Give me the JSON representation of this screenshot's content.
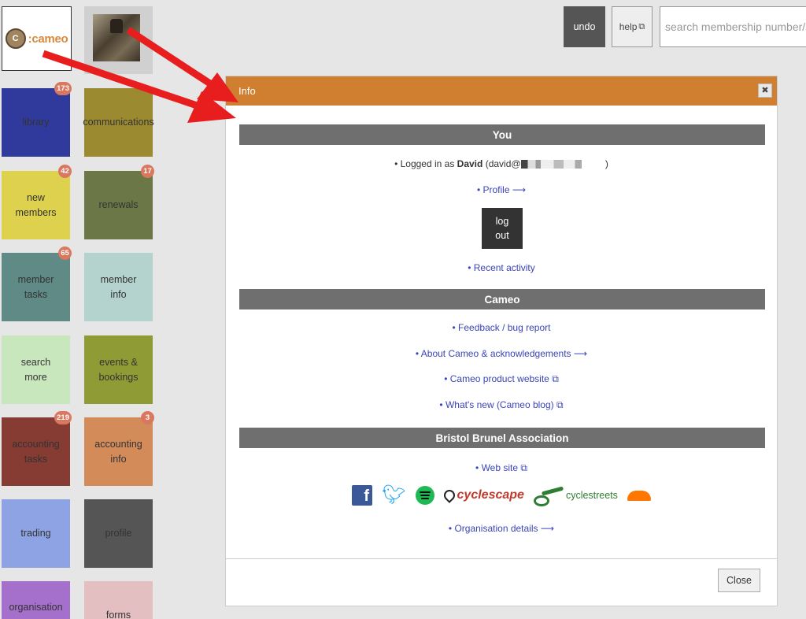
{
  "app": {
    "logo_mark": "C",
    "logo_text": ":cameo"
  },
  "tiles": [
    {
      "label": "library",
      "badge": "173",
      "color": "#303a9c"
    },
    {
      "label": "communications",
      "badge": "",
      "color": "#9b8a30"
    },
    {
      "label": "new\nmembers",
      "badge": "42",
      "color": "#ddd14d"
    },
    {
      "label": "renewals",
      "badge": "17",
      "color": "#6b7747"
    },
    {
      "label": "member\ntasks",
      "badge": "65",
      "color": "#5f8a85"
    },
    {
      "label": "member\ninfo",
      "badge": "",
      "color": "#b5d3ce"
    },
    {
      "label": "search\nmore",
      "badge": "",
      "color": "#c9e7bd"
    },
    {
      "label": "events &\nbookings",
      "badge": "",
      "color": "#8f9b34"
    },
    {
      "label": "accounting\ntasks",
      "badge": "219",
      "color": "#863b33"
    },
    {
      "label": "accounting\ninfo",
      "badge": "3",
      "color": "#d38b5a"
    },
    {
      "label": "trading",
      "badge": "",
      "color": "#8ea3e3"
    },
    {
      "label": "profile",
      "badge": "",
      "color": "#555555"
    },
    {
      "label": "organisation",
      "badge": "",
      "color": "#a570cc"
    },
    {
      "label": "forms",
      "badge": "",
      "color": "#e4bfc2"
    }
  ],
  "toolbar": {
    "undo_label": "undo",
    "help_label": "help",
    "search_placeholder": "search membership number/s, n"
  },
  "modal": {
    "title": "Info",
    "close_x": "✖",
    "you_heading": "You",
    "logged_in_prefix": "• Logged in as ",
    "user_name": "David",
    "email_prefix": " (david@",
    "email_suffix": " )",
    "profile_link": "• Profile ⟶",
    "logout_label": "log\nout",
    "recent_activity": "• Recent activity",
    "cameo_heading": "Cameo",
    "feedback_link": "• Feedback / bug report",
    "about_link": "• About Cameo & acknowledgements ⟶",
    "product_link": "• Cameo product website",
    "whats_new_link": "• What's new (Cameo blog)",
    "org_heading": "Bristol Brunel Association",
    "website_link": "• Web site",
    "cyclescape_label": "cyclescape",
    "cyclestreets_label": "cyclestreets",
    "org_details_link": "• Organisation details ⟶",
    "close_button": "Close"
  },
  "colors": {
    "modal_header": "#d07f30",
    "section_bar": "#6f6f6f",
    "link": "#3b44b8",
    "badge": "#d9775f",
    "arrow": "#e81e1e"
  }
}
